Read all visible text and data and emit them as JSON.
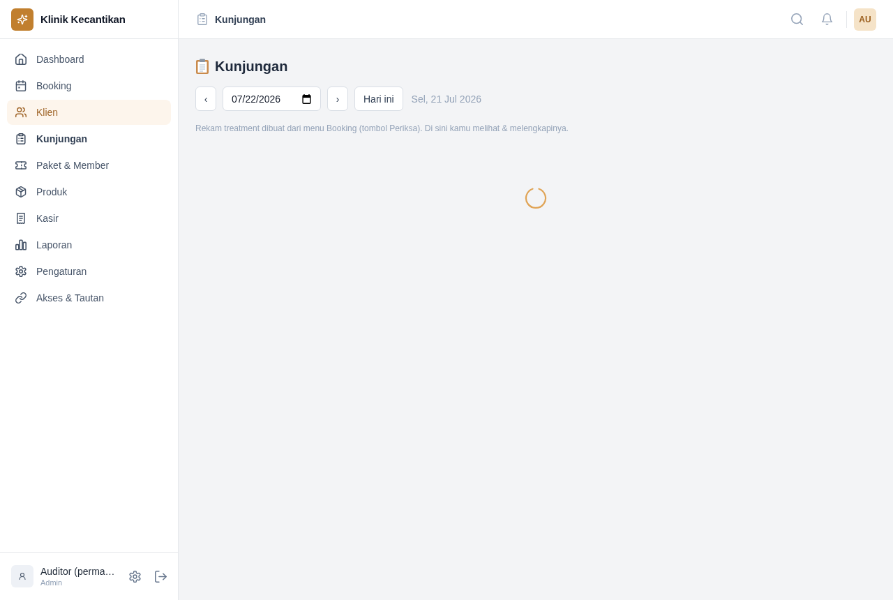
{
  "sidebar": {
    "brand": "Klinik Kecantikan",
    "items": [
      {
        "label": "Dashboard",
        "selected": false,
        "highlighted": false
      },
      {
        "label": "Booking",
        "selected": false,
        "highlighted": false
      },
      {
        "label": "Klien",
        "selected": false,
        "highlighted": true
      },
      {
        "label": "Kunjungan",
        "selected": true,
        "highlighted": false
      },
      {
        "label": "Paket & Member",
        "selected": false,
        "highlighted": false
      },
      {
        "label": "Produk",
        "selected": false,
        "highlighted": false
      },
      {
        "label": "Kasir",
        "selected": false,
        "highlighted": false
      },
      {
        "label": "Laporan",
        "selected": false,
        "highlighted": false
      },
      {
        "label": "Pengaturan",
        "selected": false,
        "highlighted": false
      },
      {
        "label": "Akses & Tautan",
        "selected": false,
        "highlighted": false
      }
    ],
    "user": {
      "name": "Auditor (perma…",
      "role": "Admin"
    }
  },
  "header": {
    "title": "Kunjungan",
    "avatar_initials": "AU"
  },
  "content": {
    "title": "Kunjungan",
    "date_nav": {
      "prev": "‹",
      "date": "07/22/2026",
      "next": "›",
      "today": "Hari ini",
      "date_label": "Sel, 21 Jul 2026"
    },
    "hint": "Rekam treatment dibuat dari menu Booking (tombol Periksa). Di sini kamu melihat & melengkapinya.",
    "loading": true
  }
}
